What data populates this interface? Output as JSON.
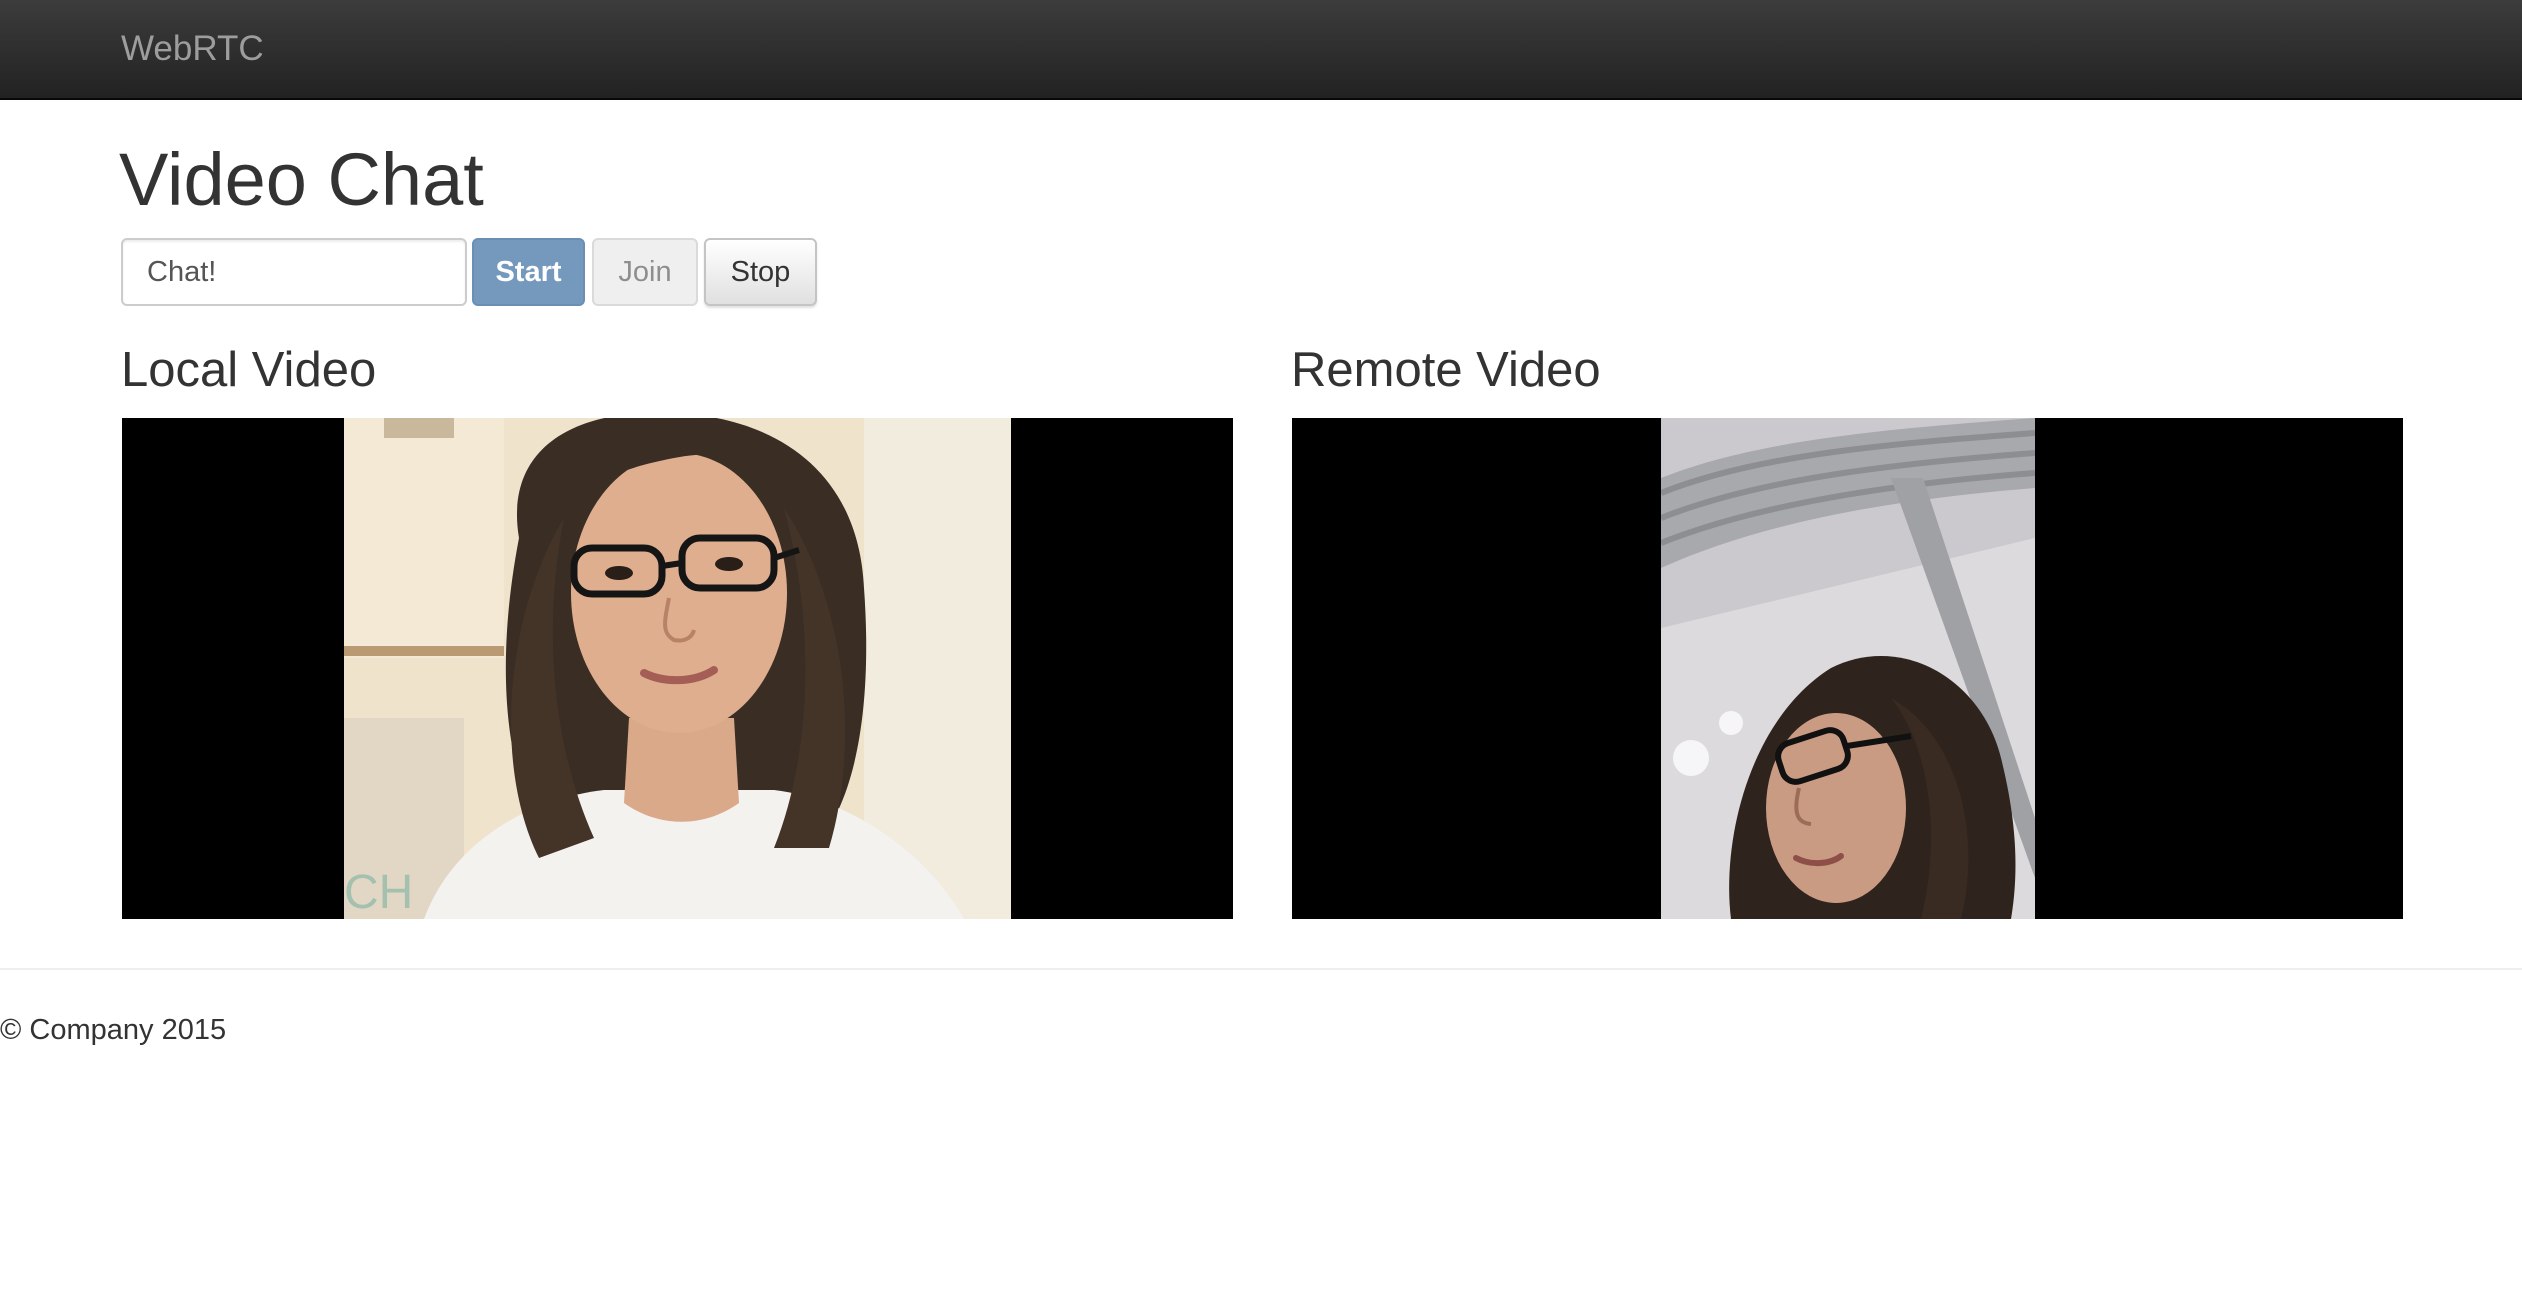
{
  "navbar": {
    "brand": "WebRTC"
  },
  "page": {
    "title": "Video Chat"
  },
  "controls": {
    "room_input_value": "Chat!",
    "start_label": "Start",
    "join_label": "Join",
    "stop_label": "Stop"
  },
  "local": {
    "heading": "Local Video"
  },
  "remote": {
    "heading": "Remote Video"
  },
  "footer": {
    "copyright": "© Company 2015"
  },
  "colors": {
    "navbar": "#222222",
    "brand_text": "#9d9d9d",
    "start_button": "#7499bd",
    "video_background": "#000000"
  }
}
